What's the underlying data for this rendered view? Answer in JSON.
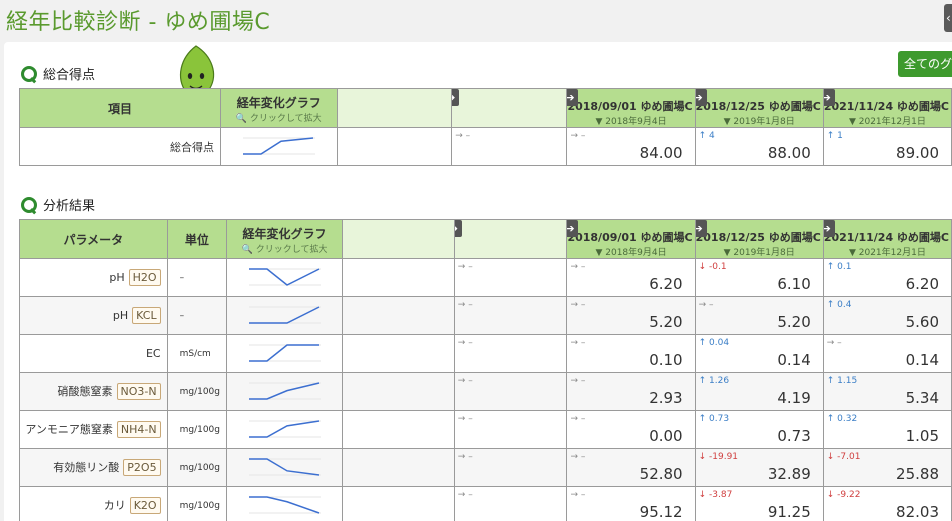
{
  "page": {
    "title": "経年比較診断 - ゆめ圃場C"
  },
  "toolbar": {
    "all_label": "全てのグ"
  },
  "score_section": {
    "title": "総合得点"
  },
  "analysis_section": {
    "title": "分析結果"
  },
  "headers": {
    "item": "項目",
    "parameter": "パラメータ",
    "unit": "単位",
    "graph_title": "経年変化グラフ",
    "graph_hint": "🔍 クリックして拡大"
  },
  "columns": [
    {
      "date": "2018/09/01 ゆめ圃場C",
      "filter": "▼ 2018年9月4日"
    },
    {
      "date": "2018/12/25 ゆめ圃場C",
      "filter": "▼ 2019年1月8日"
    },
    {
      "date": "2021/11/24 ゆめ圃場C",
      "filter": "▼ 2021年12月1日"
    }
  ],
  "score_row": {
    "label": "総合得点",
    "empty_delta": "→ –",
    "values": [
      {
        "delta": "→ –",
        "value": "84.00",
        "dir": "flat"
      },
      {
        "delta": "↑ 4",
        "value": "88.00",
        "dir": "up"
      },
      {
        "delta": "↑ 1",
        "value": "89.00",
        "dir": "up"
      }
    ],
    "trend": [
      84,
      88,
      89
    ]
  },
  "rows": [
    {
      "label": "pH",
      "formula": "H2O",
      "unit": "–",
      "empty_delta": "→ –",
      "values": [
        {
          "delta": "→ –",
          "value": "6.20",
          "dir": "flat"
        },
        {
          "delta": "↓ -0.1",
          "value": "6.10",
          "dir": "down"
        },
        {
          "delta": "↑ 0.1",
          "value": "6.20",
          "dir": "up"
        }
      ],
      "trend": [
        6.2,
        6.1,
        6.2
      ]
    },
    {
      "label": "pH",
      "formula": "KCL",
      "unit": "–",
      "empty_delta": "→ –",
      "values": [
        {
          "delta": "→ –",
          "value": "5.20",
          "dir": "flat"
        },
        {
          "delta": "→ –",
          "value": "5.20",
          "dir": "flat"
        },
        {
          "delta": "↑ 0.4",
          "value": "5.60",
          "dir": "up"
        }
      ],
      "trend": [
        5.2,
        5.2,
        5.6
      ]
    },
    {
      "label": "EC",
      "formula": "",
      "unit": "mS/cm",
      "empty_delta": "→ –",
      "values": [
        {
          "delta": "→ –",
          "value": "0.10",
          "dir": "flat"
        },
        {
          "delta": "↑ 0.04",
          "value": "0.14",
          "dir": "up"
        },
        {
          "delta": "→ –",
          "value": "0.14",
          "dir": "flat"
        }
      ],
      "trend": [
        0.1,
        0.14,
        0.14
      ]
    },
    {
      "label": "硝酸態窒素",
      "formula": "NO3-N",
      "unit": "mg/100g",
      "empty_delta": "→ –",
      "values": [
        {
          "delta": "→ –",
          "value": "2.93",
          "dir": "flat"
        },
        {
          "delta": "↑ 1.26",
          "value": "4.19",
          "dir": "up"
        },
        {
          "delta": "↑ 1.15",
          "value": "5.34",
          "dir": "up"
        }
      ],
      "trend": [
        2.93,
        4.19,
        5.34
      ]
    },
    {
      "label": "アンモニア態窒素",
      "formula": "NH4-N",
      "unit": "mg/100g",
      "empty_delta": "→ –",
      "values": [
        {
          "delta": "→ –",
          "value": "0.00",
          "dir": "flat"
        },
        {
          "delta": "↑ 0.73",
          "value": "0.73",
          "dir": "up"
        },
        {
          "delta": "↑ 0.32",
          "value": "1.05",
          "dir": "up"
        }
      ],
      "trend": [
        0.0,
        0.73,
        1.05
      ]
    },
    {
      "label": "有効態リン酸",
      "formula": "P2O5",
      "unit": "mg/100g",
      "empty_delta": "→ –",
      "values": [
        {
          "delta": "→ –",
          "value": "52.80",
          "dir": "flat"
        },
        {
          "delta": "↓ -19.91",
          "value": "32.89",
          "dir": "down"
        },
        {
          "delta": "↓ -7.01",
          "value": "25.88",
          "dir": "down"
        }
      ],
      "trend": [
        52.8,
        32.89,
        25.88
      ]
    },
    {
      "label": "カリ",
      "formula": "K2O",
      "unit": "mg/100g",
      "empty_delta": "→ –",
      "values": [
        {
          "delta": "→ –",
          "value": "95.12",
          "dir": "flat"
        },
        {
          "delta": "↓ -3.87",
          "value": "91.25",
          "dir": "down"
        },
        {
          "delta": "↓ -9.22",
          "value": "82.03",
          "dir": "down"
        }
      ],
      "trend": [
        95.12,
        91.25,
        82.03
      ]
    }
  ],
  "colors": {
    "accent": "#5a9a2e",
    "header_bg": "#b5dd8f",
    "line": "#3c6fd0",
    "up": "#3b7ec6",
    "down": "#d04040"
  },
  "icons": {
    "section": "search-icon",
    "column_nav": "arrow-right-icon"
  }
}
